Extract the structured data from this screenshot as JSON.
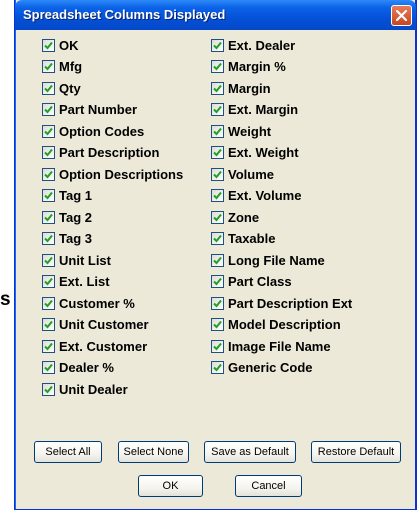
{
  "background_fragment": {
    "text": "s"
  },
  "dialog": {
    "title": "Spreadsheet Columns Displayed",
    "close_icon": "close-x-icon",
    "checkbox_icon": "checkmark-icon",
    "accent_color": "#0551d9",
    "check_color": "#21a121",
    "columns_left": [
      {
        "label": "OK",
        "checked": true
      },
      {
        "label": "Mfg",
        "checked": true
      },
      {
        "label": "Qty",
        "checked": true
      },
      {
        "label": "Part Number",
        "checked": true
      },
      {
        "label": "Option Codes",
        "checked": true
      },
      {
        "label": "Part Description",
        "checked": true
      },
      {
        "label": "Option Descriptions",
        "checked": true
      },
      {
        "label": "Tag 1",
        "checked": true
      },
      {
        "label": "Tag 2",
        "checked": true
      },
      {
        "label": "Tag 3",
        "checked": true
      },
      {
        "label": "Unit List",
        "checked": true
      },
      {
        "label": "Ext. List",
        "checked": true
      },
      {
        "label": "Customer %",
        "checked": true
      },
      {
        "label": "Unit Customer",
        "checked": true
      },
      {
        "label": "Ext. Customer",
        "checked": true
      },
      {
        "label": "Dealer %",
        "checked": true
      },
      {
        "label": "Unit Dealer",
        "checked": true
      }
    ],
    "columns_right": [
      {
        "label": "Ext. Dealer",
        "checked": true
      },
      {
        "label": "Margin %",
        "checked": true
      },
      {
        "label": "Margin",
        "checked": true
      },
      {
        "label": "Ext. Margin",
        "checked": true
      },
      {
        "label": "Weight",
        "checked": true
      },
      {
        "label": "Ext. Weight",
        "checked": true
      },
      {
        "label": "Volume",
        "checked": true
      },
      {
        "label": "Ext. Volume",
        "checked": true
      },
      {
        "label": "Zone",
        "checked": true
      },
      {
        "label": "Taxable",
        "checked": true
      },
      {
        "label": "Long File Name",
        "checked": true
      },
      {
        "label": "Part Class",
        "checked": true
      },
      {
        "label": "Part Description Ext",
        "checked": true
      },
      {
        "label": "Model Description",
        "checked": true
      },
      {
        "label": "Image File Name",
        "checked": true
      },
      {
        "label": "Generic Code",
        "checked": true
      }
    ],
    "buttons": {
      "select_all": "Select All",
      "select_none": "Select None",
      "save_default": "Save as Default",
      "restore_default": "Restore Default",
      "ok": "OK",
      "cancel": "Cancel"
    }
  }
}
